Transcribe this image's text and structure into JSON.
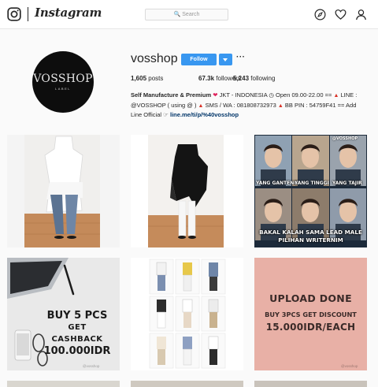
{
  "topnav": {
    "brand": "Instagram",
    "search_placeholder": "Search",
    "icons": [
      "instagram-glyph-icon",
      "compass-icon",
      "heart-icon",
      "person-icon",
      "search-icon"
    ]
  },
  "profile": {
    "avatar_text": "VOSSHOP",
    "avatar_subtext": "LABEL",
    "username": "vosshop",
    "follow_label": "Follow",
    "more_label": "···",
    "stats": {
      "posts_count": "1,605",
      "posts_label": "posts",
      "followers_count": "67.3k",
      "followers_label": "followers",
      "following_count": "5,243",
      "following_label": "following"
    },
    "bio": {
      "name": "Self Manufacture & Premium",
      "line1_rest": "JKT - INDONESIA",
      "open_hours": "Open 09.00-22.00 ==",
      "line_label": "LINE :",
      "line2a": "@VOSSHOP ( using @ )",
      "line2b": "SMS / WA : 081808732973",
      "line2c": "BB PIN : 54759F41 == Add",
      "line3": "Line Official",
      "link": "line.me/ti/p/%40vosshop"
    }
  },
  "posts": {
    "tile3": {
      "tag": "@VOSSHOP",
      "label1": "YANG GANTENG",
      "label2": "YANG TINGGI",
      "label3": "YANG TAJIR",
      "bottom1": "BAKAL KALAH SAMA LEAD MALE",
      "bottom2": "PILIHAN WRITERNIM"
    },
    "tile4": {
      "line1": "BUY 5 PCS",
      "line2": "GET CASHBACK",
      "line3": "100.000IDR",
      "watermark": "@vosshop"
    },
    "tile6": {
      "line1": "UPLOAD DONE",
      "line2": "BUY 3PCS GET DISCOUNT",
      "line3": "15.000IDR/EACH",
      "watermark": "@vosshop"
    }
  },
  "colors": {
    "accent": "#3897f0",
    "text": "#262626",
    "link": "#003569",
    "background": "#fafafa",
    "promo_pink": "#e8b0a6"
  }
}
